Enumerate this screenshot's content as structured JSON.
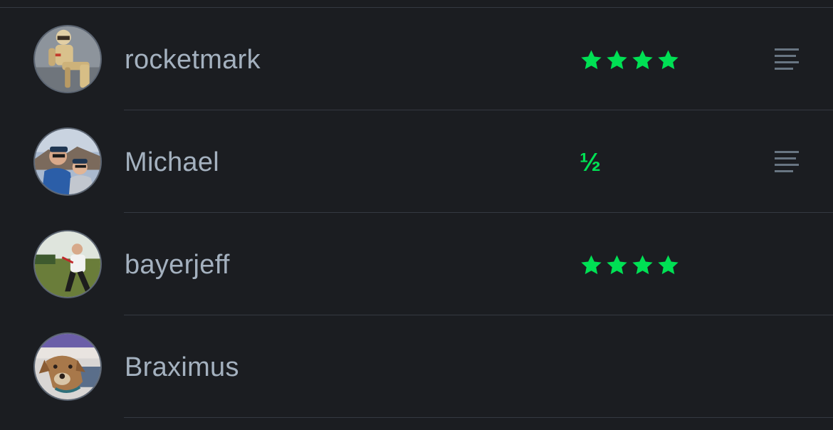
{
  "colors": {
    "background": "#1b1d21",
    "divider": "#353941",
    "username": "#a4b1bf",
    "star": "#00e054",
    "review_icon": "#687582"
  },
  "members": [
    {
      "username": "rocketmark",
      "rating": 4,
      "rating_display": "★★★★",
      "has_review": true,
      "avatar": "stormtrooper-figure-avatar"
    },
    {
      "username": "Michael",
      "rating": 0.5,
      "rating_display": "½",
      "has_review": true,
      "avatar": "couple-outdoors-avatar"
    },
    {
      "username": "bayerjeff",
      "rating": 4,
      "rating_display": "★★★★",
      "has_review": false,
      "avatar": "man-in-field-avatar"
    },
    {
      "username": "Braximus",
      "rating": null,
      "rating_display": "",
      "has_review": false,
      "avatar": "dog-avatar"
    }
  ]
}
